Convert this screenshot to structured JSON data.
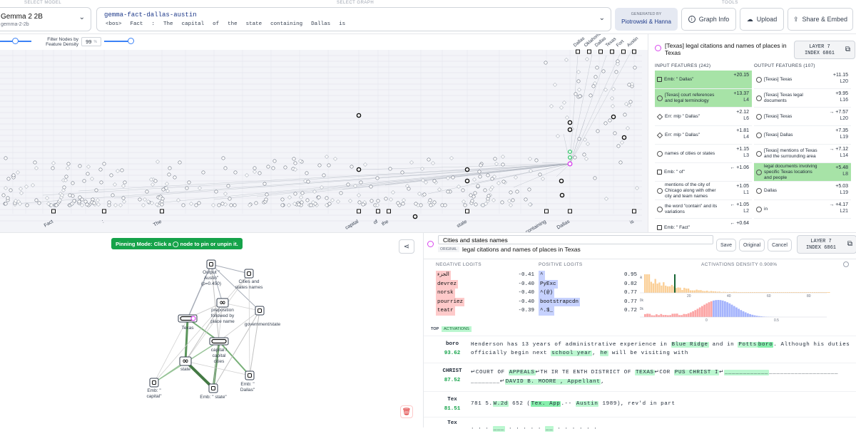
{
  "top": {
    "select_model_label": "SELECT MODEL",
    "select_graph_label": "SELECT GRAPH",
    "tools_label": "TOOLS",
    "model_name": "Gemma 2 2B",
    "model_sub": "gemma-2-2b",
    "graph_name": "gemma-fact-dallas-austin",
    "graph_tokens": [
      "<bos>",
      "Fact",
      ":",
      "The",
      "capital",
      "of",
      "the",
      "state",
      "containing",
      "Dallas",
      "is"
    ],
    "generated_by_label": "GENERATED BY",
    "generated_by": "Piotrowski & Hanna",
    "graph_info": "Graph Info",
    "upload": "Upload",
    "share": "Share & Embed"
  },
  "filter": {
    "label_line1": "Filter Nodes by",
    "label_line2": "Feature Density",
    "value": "99",
    "unit": "%"
  },
  "graph_top": {
    "x_tokens": [
      "Fact",
      ":",
      "The",
      "capital",
      "of",
      "the",
      "state",
      "containing",
      "Dallas",
      "is"
    ],
    "top_tokens": [
      "Dallas",
      "Oklahoma",
      "Dallas",
      "Texas",
      "Fort",
      "Austin"
    ]
  },
  "right_panel": {
    "title": "[Texas] legal citations and names of places in Texas",
    "layer_label": "LAYER 7",
    "index_label": "INDEX 6861",
    "input_header": "INPUT FEATURES (242)",
    "output_header": "OUTPUT FEATURES (107)",
    "inputs": [
      {
        "label": "Emb: \" Dallas\"",
        "value": "+20.15",
        "layer": "",
        "green": true,
        "icon": "sq"
      },
      {
        "label": "[Texas] court references and legal terminology",
        "value": "+13.37",
        "layer": "L4",
        "green": true,
        "icon": "circ"
      },
      {
        "label": "Err: mlp \" Dallas\"",
        "value": "+2.12",
        "layer": "L6",
        "green": false,
        "icon": "diamond"
      },
      {
        "label": "Err: mlp \" Dallas\"",
        "value": "+1.81",
        "layer": "L4",
        "green": false,
        "icon": "diamond"
      },
      {
        "label": "names of cities or states",
        "value": "+1.15",
        "layer": "L3",
        "green": false,
        "icon": "circ"
      },
      {
        "label": "Emb: \" of\"",
        "value": "← +1.06",
        "layer": "",
        "green": false,
        "icon": "sq"
      },
      {
        "label": "mentions of the city of Chicago along with other city and team names",
        "value": "+1.05",
        "layer": "L1",
        "green": false,
        "icon": "circ"
      },
      {
        "label": "the word \"contain\" and its variations",
        "value": "← +1.05",
        "layer": "L2",
        "green": false,
        "icon": "circ"
      },
      {
        "label": "Emb: \" Fact\"",
        "value": "← +0.64",
        "layer": "",
        "green": false,
        "icon": "sq"
      }
    ],
    "outputs": [
      {
        "label": "[Texas] Texas",
        "value": "+11.15",
        "layer": "L20",
        "green": false
      },
      {
        "label": "[Texas] Texas legal documents",
        "value": "+9.95",
        "layer": "L16",
        "green": false
      },
      {
        "label": "[Texas] Texas",
        "value": "→ +7.57",
        "layer": "L20",
        "green": false
      },
      {
        "label": "[Texas] Dallas",
        "value": "+7.35",
        "layer": "L19",
        "green": false
      },
      {
        "label": "[Texas] mentions of Texas and the surrounding area",
        "value": "→ +7.12",
        "layer": "L14",
        "green": false
      },
      {
        "label": "legal documents involving specific Texas locations and people",
        "value": "+5.48",
        "layer": "L8",
        "green": true
      },
      {
        "label": "Dallas",
        "value": "+5.03",
        "layer": "L19",
        "green": false
      },
      {
        "label": "in",
        "value": "→ +4.17",
        "layer": "L21",
        "green": false
      }
    ]
  },
  "pin": {
    "text": "Pinning Mode: Click a ◯ node to pin or unpin it."
  },
  "subgraph": {
    "nodes": [
      {
        "label": "Output \" Austin\" (p=0.450)"
      },
      {
        "label": "Cities and states names"
      },
      {
        "label": "preposition followed by place name"
      },
      {
        "label": "government/state"
      },
      {
        "label": "Texas"
      },
      {
        "label": "capital / capital cities"
      },
      {
        "label": "state"
      },
      {
        "label": "Emb: \" capital\""
      },
      {
        "label": "Emb: \" Dallas\""
      },
      {
        "label": "Emb: \" state\""
      }
    ]
  },
  "detail": {
    "input_value": "Cities and states names",
    "original_tag": "ORIGINAL",
    "original_text": "legal citations and names of places in Texas",
    "save": "Save",
    "original": "Original",
    "cancel": "Cancel",
    "layer_label": "LAYER 7",
    "index_label": "INDEX 6861",
    "neg_header": "NEGATIVE LOGITS",
    "pos_header": "POSITIVE LOGITS",
    "density_header": "ACTIVATIONS DENSITY 0.908%",
    "neg": [
      {
        "t": "الجزء",
        "v": "-0.41"
      },
      {
        "t": "devrez",
        "v": "-0.40"
      },
      {
        "t": "norsk",
        "v": "-0.40"
      },
      {
        "t": "pourriez",
        "v": "-0.40"
      },
      {
        "t": "teatr",
        "v": "-0.39"
      }
    ],
    "pos": [
      {
        "t": "^",
        "v": "0.95"
      },
      {
        "t": "PyExc",
        "v": "0.82"
      },
      {
        "t": "^(@)",
        "v": "0.77"
      },
      {
        "t": "bootstrapcdn",
        "v": "0.77"
      },
      {
        "t": "^.$_",
        "v": "0.72"
      }
    ],
    "hist1_ticks": [
      "5k",
      "20",
      "40",
      "60",
      "80"
    ],
    "hist2_ticks": [
      "20k",
      "10k",
      "0",
      "0.5"
    ],
    "top_tag": "TOP",
    "act_tag": "ACTIVATIONS",
    "rows": [
      {
        "word": "boro",
        "value": "93.62"
      },
      {
        "word": "CHRIST",
        "value": "87.52"
      },
      {
        "word": "Tex",
        "value": "81.51"
      },
      {
        "word": "Tex",
        "value": ""
      }
    ]
  }
}
